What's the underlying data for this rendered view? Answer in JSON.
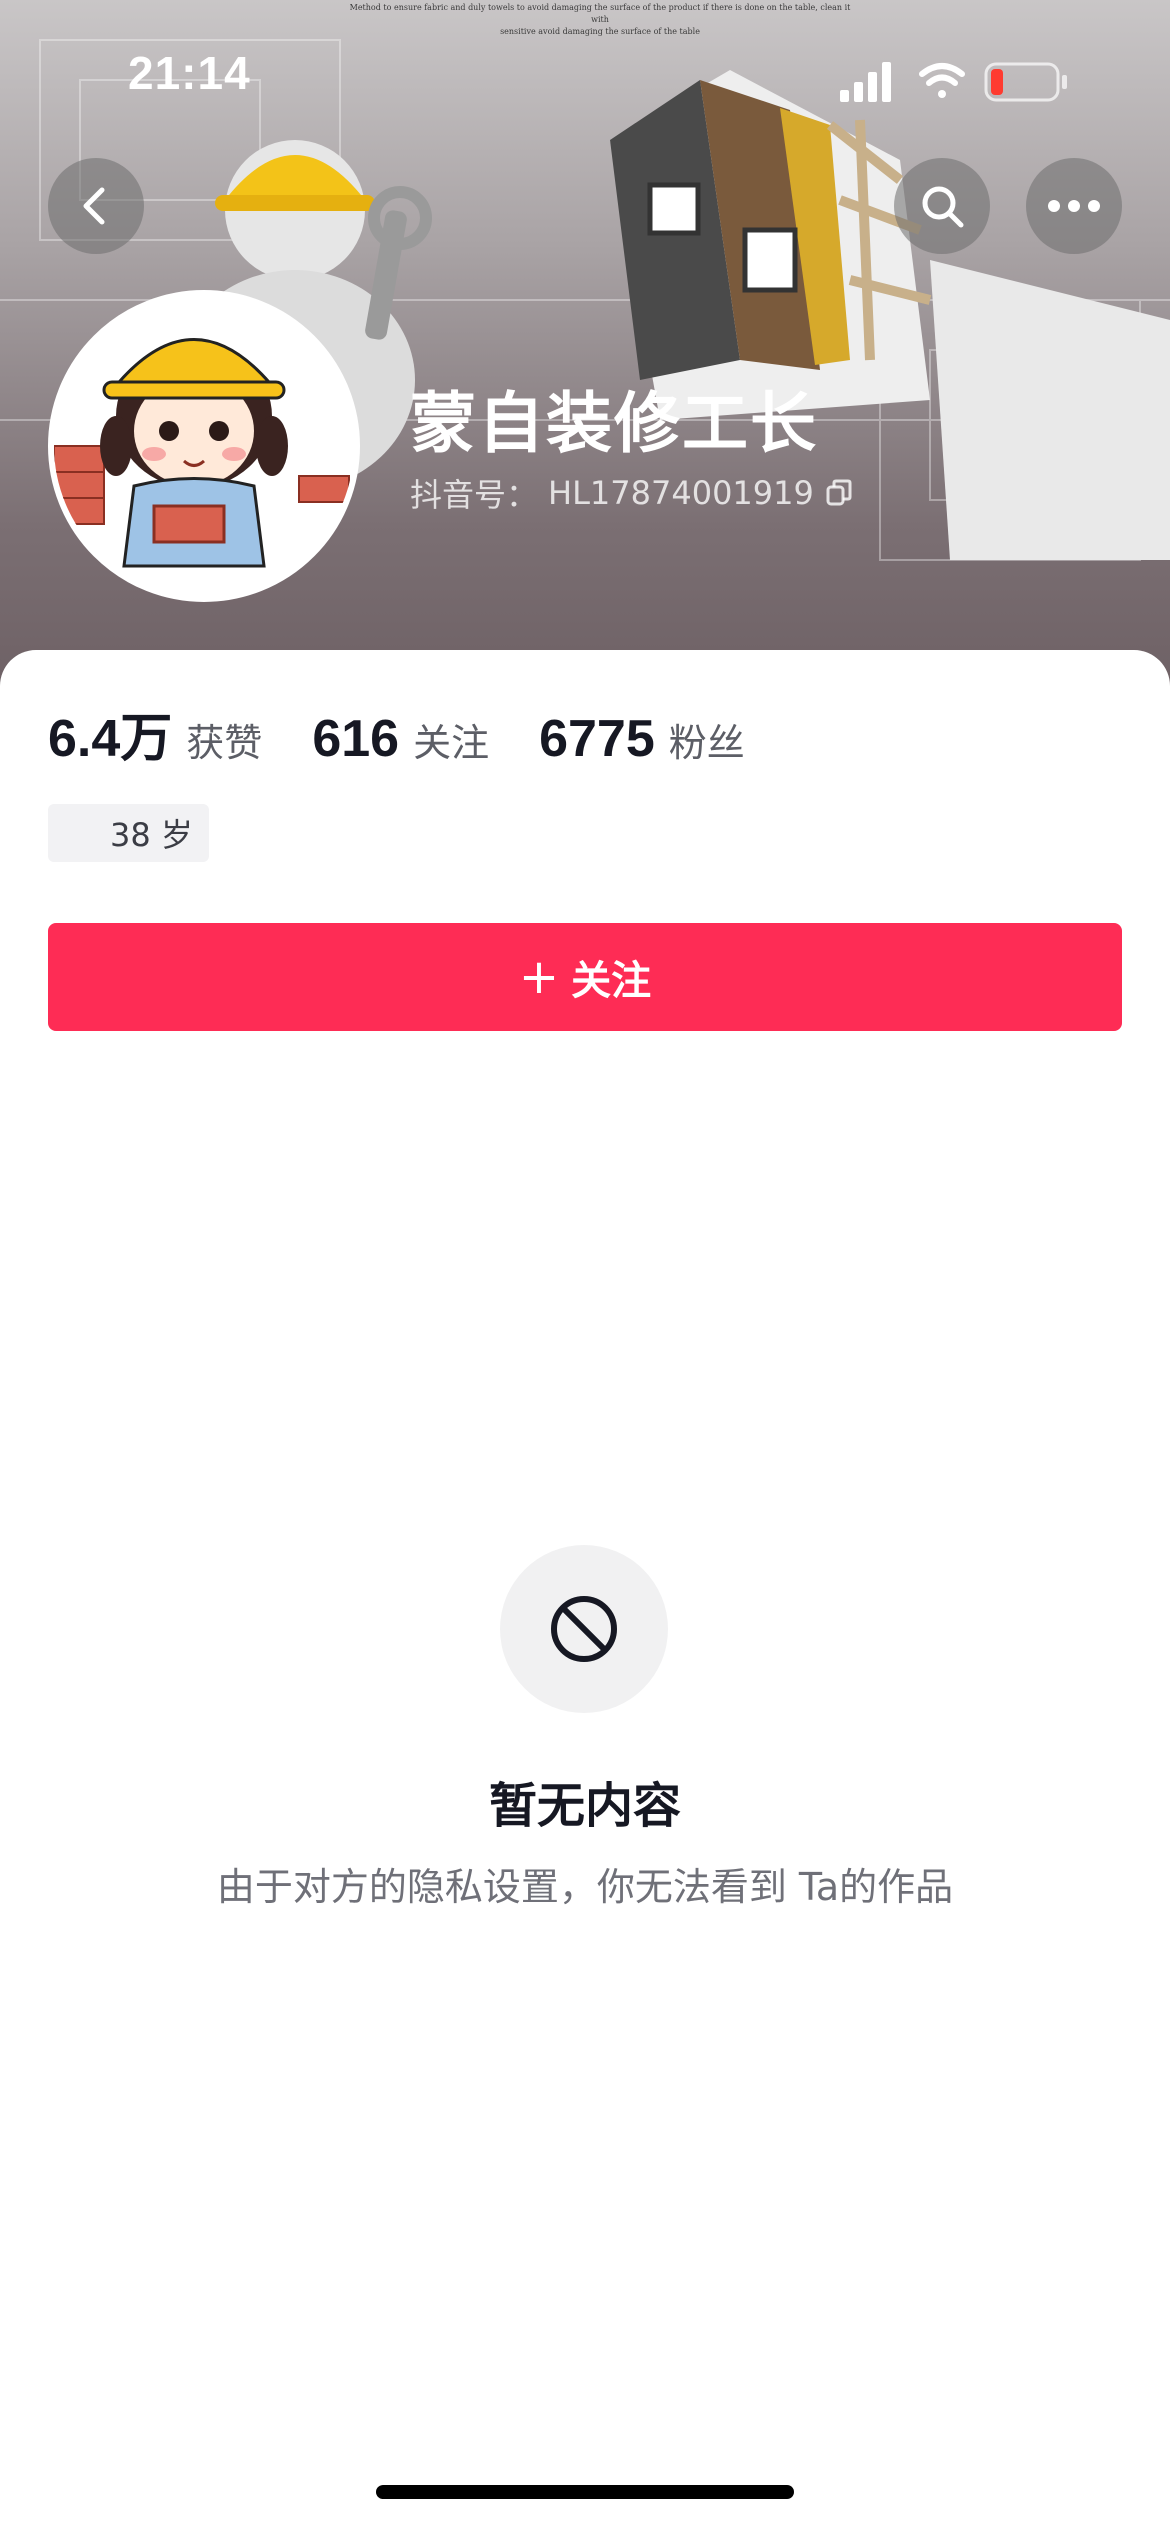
{
  "status_bar": {
    "time": "21:14",
    "icons": [
      "signal-icon",
      "wifi-icon",
      "battery-low-icon"
    ]
  },
  "header": {
    "caption_line1": "Method to ensure fabric and duly towels to avoid damaging the surface of the product if there is done on the table, clean it with",
    "caption_line2": "sensitive avoid damaging the surface of the table"
  },
  "nav": {
    "back_icon": "chevron-left-icon",
    "search_icon": "search-icon",
    "more_icon": "more-horizontal-icon"
  },
  "profile": {
    "name": "蒙自装修工长",
    "douyin_id_label": "抖音号：",
    "douyin_id": "HL17874001919",
    "copy_icon": "copy-icon"
  },
  "stats": [
    {
      "value": "6.4万",
      "label": "获赞"
    },
    {
      "value": "616",
      "label": "关注"
    },
    {
      "value": "6775",
      "label": "粉丝"
    }
  ],
  "age_tag": "38 岁",
  "follow_button": {
    "plus": "+",
    "label": "关注"
  },
  "empty_state": {
    "icon": "block-icon",
    "title": "暂无内容",
    "description": "由于对方的隐私设置，你无法看到 Ta的作品"
  },
  "colors": {
    "accent": "#fe2c55",
    "header_bg": "#7b6f73"
  }
}
